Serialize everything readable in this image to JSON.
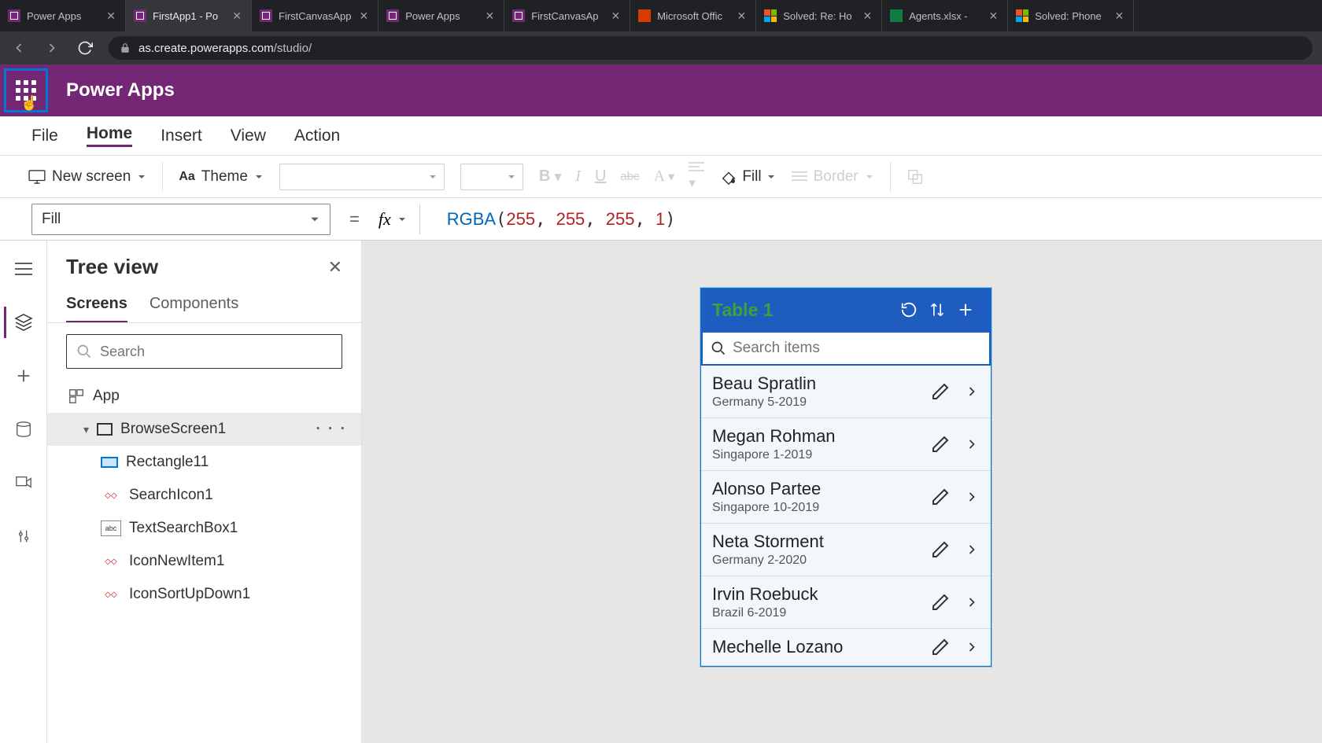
{
  "browser": {
    "tabs": [
      {
        "title": "Power Apps",
        "favicon": "pa"
      },
      {
        "title": "FirstApp1 - Po",
        "favicon": "pa",
        "active": true
      },
      {
        "title": "FirstCanvasApp",
        "favicon": "pa"
      },
      {
        "title": "Power Apps",
        "favicon": "pa"
      },
      {
        "title": "FirstCanvasAp",
        "favicon": "pa"
      },
      {
        "title": "Microsoft Offic",
        "favicon": "ms"
      },
      {
        "title": "Solved: Re: Ho",
        "favicon": "win"
      },
      {
        "title": "Agents.xlsx - ",
        "favicon": "excel"
      },
      {
        "title": "Solved: Phone",
        "favicon": "win"
      }
    ],
    "address": {
      "host": "as.create.powerapps.com",
      "path": "/studio/"
    }
  },
  "header": {
    "app_name": "Power Apps"
  },
  "ribbon": {
    "tabs": [
      "File",
      "Home",
      "Insert",
      "View",
      "Action"
    ],
    "active_tab": "Home",
    "new_screen": "New screen",
    "theme": "Theme",
    "fill_label": "Fill",
    "border_label": "Border"
  },
  "formula": {
    "property": "Fill",
    "fn": "RGBA",
    "args": [
      "255",
      "255",
      "255",
      "1"
    ]
  },
  "treeview": {
    "title": "Tree view",
    "tabs": [
      "Screens",
      "Components"
    ],
    "active_tab": "Screens",
    "search_placeholder": "Search",
    "root": "App",
    "screen": "BrowseScreen1",
    "children": [
      "Rectangle11",
      "SearchIcon1",
      "TextSearchBox1",
      "IconNewItem1",
      "IconSortUpDown1"
    ]
  },
  "preview": {
    "title": "Table 1",
    "search_placeholder": "Search items",
    "items": [
      {
        "name": "Beau Spratlin",
        "sub": "Germany 5-2019"
      },
      {
        "name": "Megan Rohman",
        "sub": "Singapore 1-2019"
      },
      {
        "name": "Alonso Partee",
        "sub": "Singapore 10-2019"
      },
      {
        "name": "Neta Storment",
        "sub": "Germany 2-2020"
      },
      {
        "name": "Irvin Roebuck",
        "sub": "Brazil 6-2019"
      },
      {
        "name": "Mechelle Lozano",
        "sub": ""
      }
    ]
  }
}
